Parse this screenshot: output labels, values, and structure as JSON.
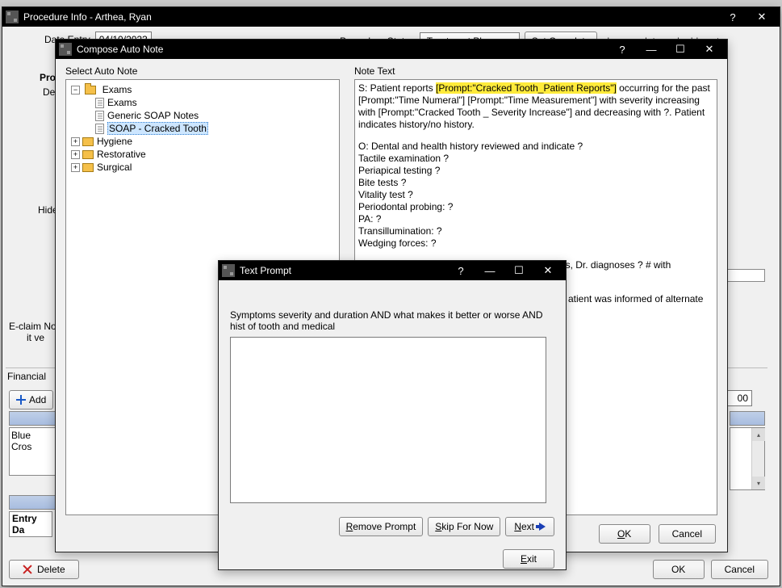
{
  "procedure_info": {
    "title": "Procedure Info - Arthea, Ryan",
    "date_entry_label": "Date Entry",
    "date_entry_value": "04/10/2023",
    "procedure_status_label": "Procedure Status",
    "procedure_status_value": "Treatment Planned",
    "set_complete_btn": "Set Complete",
    "set_complete_note": "changes date and adds note",
    "proc_label": "Proc",
    "de_label": "De",
    "hide_label": "Hide",
    "eclaim_label": "E-claim No",
    "it_ve_label": "it ve",
    "financial_label": "Financial",
    "add_btn": "Add",
    "blue_cross": "Blue Cros",
    "fee_value": "",
    "entry_date_label": "Entry Da",
    "delete_btn": "Delete",
    "ok_btn": "OK",
    "cancel_btn": "Cancel"
  },
  "compose": {
    "title": "Compose Auto Note",
    "select_label": "Select Auto Note",
    "tree": {
      "exams": "Exams",
      "items": {
        "exams_doc": "Exams",
        "soap_generic": "Generic SOAP Notes",
        "soap_cracked": "SOAP - Cracked Tooth"
      },
      "hygiene": "Hygiene",
      "restorative": "Restorative",
      "surgical": "Surgical"
    },
    "note_label": "Note Text",
    "note_s_prefix": "S: Patient reports ",
    "note_s_hl": "[Prompt:\"Cracked Tooth_Patient Reports\"]",
    "note_s_rest": " occurring for the past [Prompt:\"Time Numeral\"] [Prompt:\"Time Measurement\"] with severity increasing with [Prompt:\"Cracked Tooth _ Severity Increase\"] and decreasing with ?. Patient indicates history/no history.",
    "note_o": "O: Dental and health history reviewed and indicate ?\nTactile examination ?\nPeriapical testing ?\nBite tests ?\nVitality test ?\nPeriodontal probing: ?\nPA: ?\nTransillumination: ?\nWedging forces: ?",
    "note_a": "A: ? visible/not visible on x-ray. Based on findings, Dr. diagnoses ? # with reversable/irreversible pulpitis",
    "note_tail": "atient was informed of alternate options\n?.",
    "ok_btn": "OK",
    "cancel_btn": "Cancel"
  },
  "text_prompt": {
    "title": "Text Prompt",
    "prompt_text": "Symptoms severity and duration AND what makes it better or worse AND hist of tooth and medical",
    "remove_btn": "Remove Prompt",
    "skip_btn": "Skip For Now",
    "next_btn": "Next",
    "exit_btn": "Exit"
  }
}
